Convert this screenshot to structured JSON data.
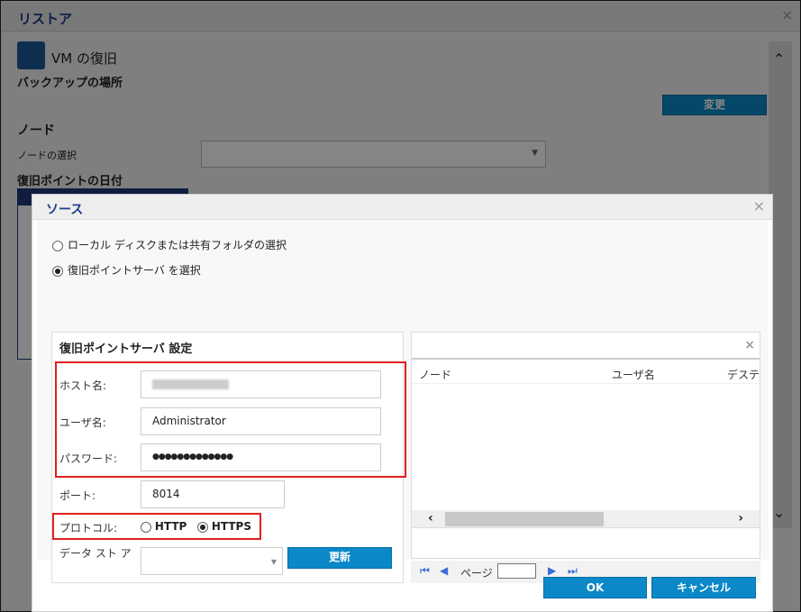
{
  "window": {
    "title": "リストア"
  },
  "background": {
    "section_title": "VM の復旧",
    "backup_location": "バックアップの場所",
    "change_button": "変更",
    "node_heading": "ノード",
    "node_select_label": "ノードの選択",
    "recovery_point_date": "復旧ポイントの日付"
  },
  "modal": {
    "title": "ソース",
    "radio_options": [
      {
        "label": "ローカル ディスクまたは共有フォルダの選択",
        "selected": false
      },
      {
        "label": "復旧ポイントサーバ を選択",
        "selected": true
      }
    ],
    "settings": {
      "title": "復旧ポイントサーバ 設定",
      "host_label": "ホスト名:",
      "host_value": "",
      "user_label": "ユーザ名:",
      "user_value": "Administrator",
      "password_label": "パスワード:",
      "password_value": "●●●●●●●●●●●●●",
      "port_label": "ポート:",
      "port_value": "8014",
      "protocol_label": "プロトコル:",
      "protocol_options": [
        "HTTP",
        "HTTPS"
      ],
      "protocol_selected": "HTTPS",
      "datastore_label": "データ スト ア",
      "refresh_button": "更新"
    },
    "table": {
      "columns": [
        "ノード",
        "ユーザ名",
        "デステ"
      ],
      "page_label": "ページ"
    },
    "ok_button": "OK",
    "cancel_button": "キャンセル"
  },
  "colors": {
    "accent": "#0a88c8",
    "highlight": "#e02020",
    "title": "#1a3a8a"
  }
}
